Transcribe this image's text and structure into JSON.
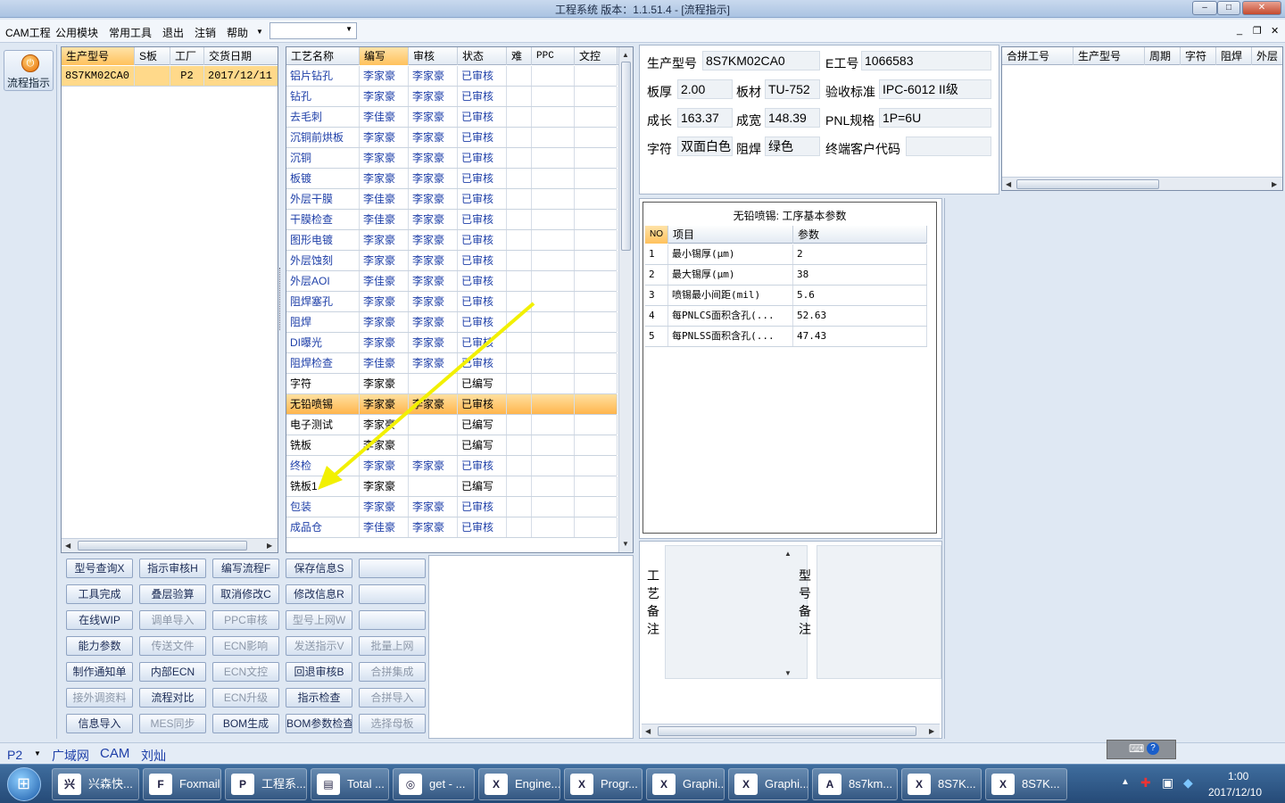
{
  "window": {
    "title": "工程系统   版本：1.1.51.4 - [流程指示]"
  },
  "menu": {
    "items": [
      "CAM工程",
      "公用模块",
      "常用工具",
      "退出",
      "注销",
      "帮助"
    ]
  },
  "left_toolbar": {
    "flow_label": "流程指示"
  },
  "order_grid": {
    "columns": [
      "生产型号",
      "S板",
      "工厂",
      "交货日期"
    ],
    "rows": [
      {
        "model": "8S7KM02CA0",
        "s": "",
        "factory": "P2",
        "date": "2017/12/11"
      }
    ]
  },
  "process_grid": {
    "columns": [
      "工艺名称",
      "编写",
      "审核",
      "状态",
      "难",
      "PPC",
      "文控"
    ],
    "rows": [
      {
        "name": "铝片钻孔",
        "writer": "李家豪",
        "reviewer": "李家豪",
        "status": "已审核"
      },
      {
        "name": "钻孔",
        "writer": "李家豪",
        "reviewer": "李家豪",
        "status": "已审核"
      },
      {
        "name": "去毛刺",
        "writer": "李佳豪",
        "reviewer": "李家豪",
        "status": "已审核"
      },
      {
        "name": "沉铜前烘板",
        "writer": "李家豪",
        "reviewer": "李家豪",
        "status": "已审核"
      },
      {
        "name": "沉铜",
        "writer": "李家豪",
        "reviewer": "李家豪",
        "status": "已审核"
      },
      {
        "name": "板镀",
        "writer": "李家豪",
        "reviewer": "李家豪",
        "status": "已审核"
      },
      {
        "name": "外层干膜",
        "writer": "李佳豪",
        "reviewer": "李家豪",
        "status": "已审核"
      },
      {
        "name": "干膜检查",
        "writer": "李佳豪",
        "reviewer": "李家豪",
        "status": "已审核"
      },
      {
        "name": "图形电镀",
        "writer": "李家豪",
        "reviewer": "李家豪",
        "status": "已审核"
      },
      {
        "name": "外层蚀刻",
        "writer": "李家豪",
        "reviewer": "李家豪",
        "status": "已审核"
      },
      {
        "name": "外层AOI",
        "writer": "李佳豪",
        "reviewer": "李家豪",
        "status": "已审核"
      },
      {
        "name": "阻焊塞孔",
        "writer": "李家豪",
        "reviewer": "李家豪",
        "status": "已审核"
      },
      {
        "name": "阻焊",
        "writer": "李家豪",
        "reviewer": "李家豪",
        "status": "已审核"
      },
      {
        "name": "DI曝光",
        "writer": "李家豪",
        "reviewer": "李家豪",
        "status": "已审核"
      },
      {
        "name": "阻焊检查",
        "writer": "李佳豪",
        "reviewer": "李家豪",
        "status": "已审核"
      },
      {
        "name": "字符",
        "writer": "李家豪",
        "reviewer": "",
        "status": "已编写"
      },
      {
        "name": "无铅喷锡",
        "writer": "李家豪",
        "reviewer": "李家豪",
        "status": "已审核"
      },
      {
        "name": "电子测试",
        "writer": "李家豪",
        "reviewer": "",
        "status": "已编写"
      },
      {
        "name": "铣板",
        "writer": "李家豪",
        "reviewer": "",
        "status": "已编写"
      },
      {
        "name": "终检",
        "writer": "李家豪",
        "reviewer": "李家豪",
        "status": "已审核"
      },
      {
        "name": "铣板1",
        "writer": "李家豪",
        "reviewer": "",
        "status": "已编写"
      },
      {
        "name": "包装",
        "writer": "李家豪",
        "reviewer": "李家豪",
        "status": "已审核"
      },
      {
        "name": "成品仓",
        "writer": "李佳豪",
        "reviewer": "李家豪",
        "status": "已审核"
      }
    ],
    "selected_index": 16
  },
  "buttons": [
    [
      "型号查询X",
      "指示审核H",
      "编写流程F",
      "保存信息S",
      ""
    ],
    [
      "工具完成",
      "叠层验算",
      "取消修改C",
      "修改信息R",
      ""
    ],
    [
      "在线WIP",
      "调单导入",
      "PPC审核",
      "型号上网W",
      ""
    ],
    [
      "能力参数",
      "传送文件",
      "ECN影响",
      "发送指示V",
      "批量上网"
    ],
    [
      "制作通知单",
      "内部ECN",
      "ECN文控",
      "回退审核B",
      "合拼集成"
    ],
    [
      "接外调资料",
      "流程对比",
      "ECN升级",
      "指示检查",
      "合拼导入"
    ],
    [
      "信息导入",
      "MES同步",
      "BOM生成",
      "BOM参数检查",
      "选择母板"
    ]
  ],
  "info": {
    "model_label": "生产型号",
    "model": "8S7KM02CA0",
    "eno_label": "E工号",
    "eno": "1066583",
    "thick_label": "板厚",
    "thick": "2.00",
    "material_label": "板材",
    "material": "TU-752",
    "std_label": "验收标准",
    "std": "IPC-6012 II级",
    "len_label": "成长",
    "len": "163.37",
    "width_label": "成宽",
    "width": "148.39",
    "pnl_label": "PNL规格",
    "pnl": "1P=6U",
    "char_label": "字符",
    "char": "双面白色",
    "mask_label": "阻焊",
    "mask": "绿色",
    "cust_label": "终端客户代码",
    "cust": ""
  },
  "combine_grid": {
    "columns": [
      "合拼工号",
      "生产型号",
      "周期",
      "字符",
      "阻焊",
      "外层"
    ]
  },
  "param_panel": {
    "title": "无铅喷锡: 工序基本参数",
    "columns": [
      "NO",
      "项目",
      "参数"
    ],
    "rows": [
      {
        "no": "1",
        "item": "最小锡厚(μm)",
        "value": "2"
      },
      {
        "no": "2",
        "item": "最大锡厚(μm)",
        "value": "38"
      },
      {
        "no": "3",
        "item": "喷锡最小间距(mil)",
        "value": "5.6"
      },
      {
        "no": "4",
        "item": "每PNLCS面积含孔(...",
        "value": "52.63"
      },
      {
        "no": "5",
        "item": "每PNLSS面积含孔(...",
        "value": "47.43"
      }
    ]
  },
  "remarks": {
    "process_label": "工艺备注",
    "model_label": "型号备注"
  },
  "statusbar": {
    "plant": "P2",
    "items": [
      "广域网",
      "CAM",
      "刘灿"
    ]
  },
  "taskbar": {
    "tasks": [
      "兴森快...",
      "Foxmail",
      "工程系...",
      "Total ...",
      "get - ...",
      "Engine...",
      "Progr...",
      "Graphi...",
      "Graphi...",
      "8s7km...",
      "8S7K...",
      "8S7K..."
    ],
    "time": "1:00",
    "date": "2017/12/10"
  },
  "colors": {
    "accent_selected": "#ffb54d",
    "link_text": "#1e3fa8",
    "arrow": "#f2f000"
  }
}
